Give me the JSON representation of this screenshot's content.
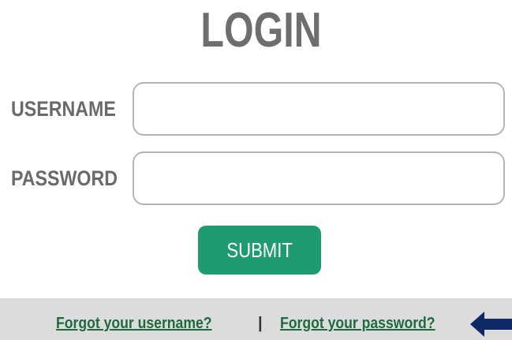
{
  "header": {
    "title": "LOGIN"
  },
  "form": {
    "username_label": "USERNAME",
    "username_value": "",
    "password_label": "PASSWORD",
    "password_value": "",
    "submit_label": "SUBMIT"
  },
  "footer": {
    "forgot_username": "Forgot your username?",
    "separator": "|",
    "forgot_password": "Forgot your password?",
    "pointer_icon": "arrow-left-icon"
  },
  "colors": {
    "title": "#6e6e6e",
    "label": "#6a6a6a",
    "submit_background": "#1e9b70",
    "link": "#1e6b41",
    "footer_background": "#dcdcdc",
    "arrow": "#0d2a66"
  }
}
